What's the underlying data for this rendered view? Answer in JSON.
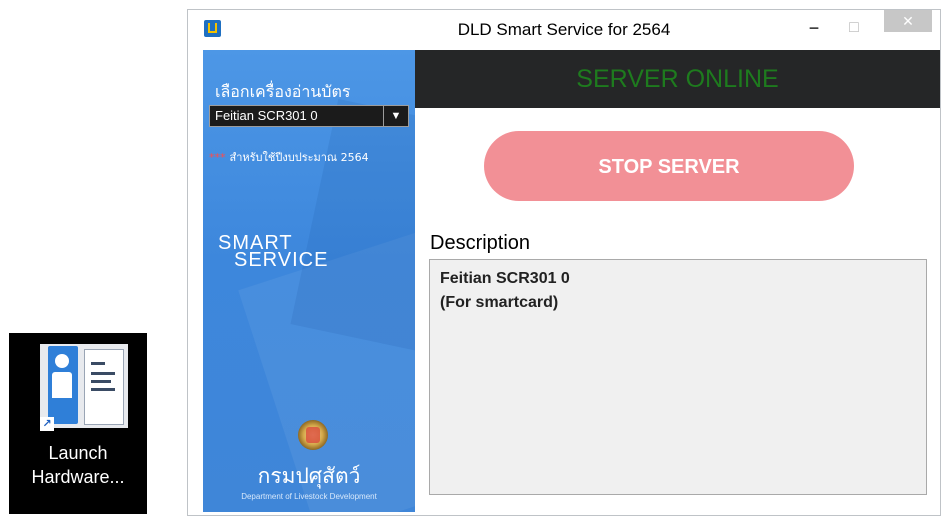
{
  "desktop": {
    "shortcut_label_line1": "Launch",
    "shortcut_label_line2": "Hardware..."
  },
  "window": {
    "title": "DLD Smart Service for 2564",
    "controls": {
      "minimize": "−",
      "maximize": "□",
      "close": "✕"
    }
  },
  "sidebar": {
    "reader_label": "เลือกเครื่องอ่านบัตร",
    "reader_selected": "Feitian SCR301 0",
    "note_stars": "***",
    "note_text": "สำหรับใช้ปีงบประมาณ 2564",
    "logo_line1": "SMART",
    "logo_line2": "SERVICE",
    "dept_thai": "กรมปศุสัตว์",
    "dept_en": "Department of Livestock Development"
  },
  "main": {
    "status": "SERVER ONLINE",
    "stop_button": "STOP SERVER",
    "description_label": "Description",
    "description_lines": [
      "Feitian SCR301 0",
      "(For smartcard)"
    ]
  },
  "colors": {
    "sidebar_blue": "#4291e0",
    "status_bg": "#252627",
    "status_text": "#1e7b1e",
    "stop_button": "#f29096"
  }
}
